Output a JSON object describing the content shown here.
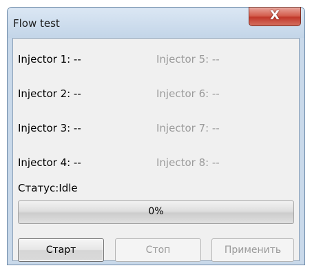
{
  "window": {
    "title": "Flow test",
    "close_glyph": "X"
  },
  "injectors": [
    {
      "label": "Injector 1: --",
      "enabled": true
    },
    {
      "label": "Injector 2: --",
      "enabled": true
    },
    {
      "label": "Injector 3: --",
      "enabled": true
    },
    {
      "label": "Injector 4: --",
      "enabled": true
    },
    {
      "label": "Injector 5: --",
      "enabled": false
    },
    {
      "label": "Injector 6: --",
      "enabled": false
    },
    {
      "label": "Injector 7: --",
      "enabled": false
    },
    {
      "label": "Injector 8: --",
      "enabled": false
    }
  ],
  "status": {
    "text": "Статус:Idle"
  },
  "progress": {
    "value": 0,
    "text": "0%",
    "fill_color": "#2ec04a"
  },
  "buttons": {
    "start_label": "Старт",
    "stop_label": "Стоп",
    "apply_label": "Применить"
  },
  "icons": {
    "close": "close-icon"
  }
}
